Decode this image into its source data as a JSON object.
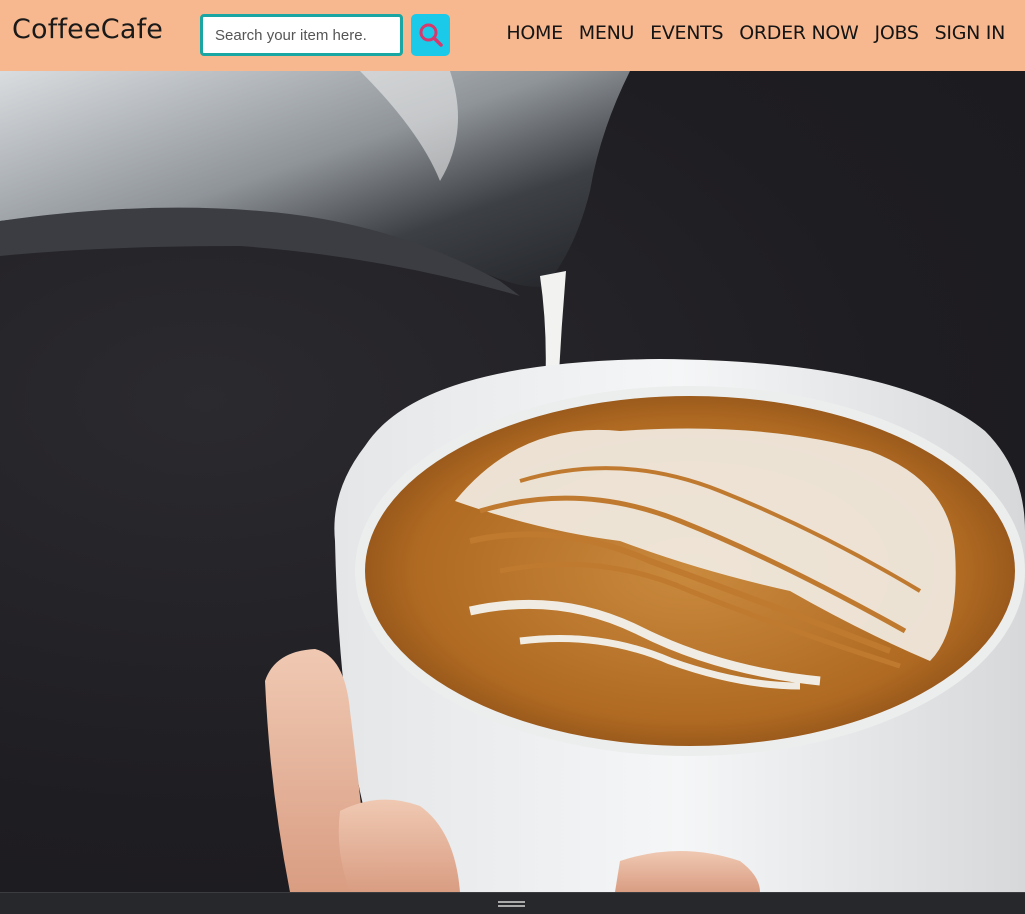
{
  "navbar": {
    "brand": "CoffeeCafe",
    "search": {
      "placeholder": "Search your item here.",
      "value": ""
    },
    "search_button_icon": "search-icon",
    "links": [
      "HOME",
      "MENU",
      "EVENTS",
      "ORDER NOW",
      "JOBS",
      "SIGN IN"
    ]
  },
  "hero": {
    "image_subject": "latte art being poured into a white cup",
    "scroll_icon": "chevron-down-icon"
  },
  "colors": {
    "navbar_bg": "#f7b88f",
    "search_border": "#1aa7a3",
    "search_button_bg": "#1bc9e8",
    "search_icon": "#d8386b"
  }
}
